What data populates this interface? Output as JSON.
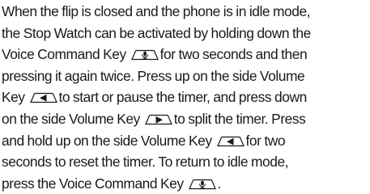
{
  "paragraph": {
    "l1": "When the flip is closed and the phone is in idle mode,",
    "l2": "the Stop Watch can be activated by holding down the",
    "l3a": "Voice Command Key",
    "l3b": "for two seconds and then",
    "l4": "pressing it again twice. Press up on the side Volume",
    "l5a": "Key",
    "l5b": "to start or pause the timer, and press down",
    "l6a": "on the side Volume Key",
    "l6b": "to split the timer. Press",
    "l7a": "and hold up on the side Volume Key",
    "l7b": "for two",
    "l8": "seconds to reset the timer. To return to idle mode,",
    "l9a": "press the Voice Command Key",
    "l9b": "."
  },
  "icons": {
    "voice_command_key": "microphone-key-icon",
    "volume_up_key": "left-arrow-key-icon",
    "volume_down_key": "right-arrow-key-icon"
  }
}
